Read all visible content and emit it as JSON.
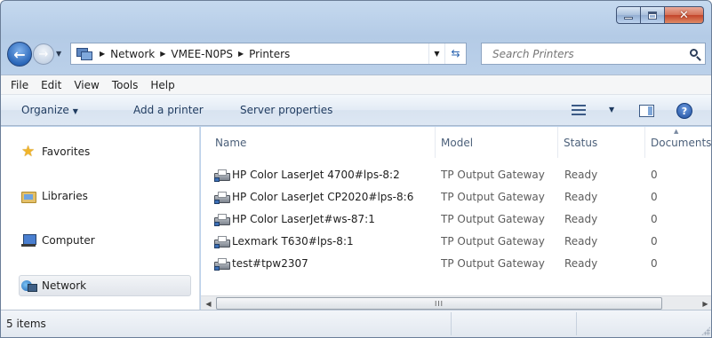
{
  "window": {
    "caption_buttons": {
      "minimize_icon": "minimize-icon",
      "maximize_icon": "maximize-icon",
      "close_glyph": "✕"
    }
  },
  "address_bar": {
    "crumbs": [
      "Network",
      "VMEE-N0PS",
      "Printers"
    ],
    "separator_glyph": "▶"
  },
  "search": {
    "placeholder": "Search Printers"
  },
  "menu": [
    "File",
    "Edit",
    "View",
    "Tools",
    "Help"
  ],
  "command_bar": {
    "organize": "Organize",
    "add_printer": "Add a printer",
    "server_properties": "Server properties"
  },
  "nav_pane": {
    "favorites": "Favorites",
    "libraries": "Libraries",
    "computer": "Computer",
    "network": "Network"
  },
  "columns": {
    "name": "Name",
    "model": "Model",
    "status": "Status",
    "documents": "Documents"
  },
  "printers": [
    {
      "name": "HP Color LaserJet 4700#lps-8:2",
      "model": "TP Output Gateway",
      "status": "Ready",
      "documents": "0"
    },
    {
      "name": "HP Color LaserJet CP2020#lps-8:6",
      "model": "TP Output Gateway",
      "status": "Ready",
      "documents": "0"
    },
    {
      "name": "HP Color LaserJet#ws-87:1",
      "model": "TP Output Gateway",
      "status": "Ready",
      "documents": "0"
    },
    {
      "name": "Lexmark T630#lps-8:1",
      "model": "TP Output Gateway",
      "status": "Ready",
      "documents": "0"
    },
    {
      "name": "test#tpw2307",
      "model": "TP Output Gateway",
      "status": "Ready",
      "documents": "0"
    }
  ],
  "scrollbar": {
    "thumb_grip": "III"
  },
  "status_bar": {
    "item_count": "5 items"
  },
  "colors": {
    "title_gradient": "#c5d9ef",
    "close_button": "#c3442a",
    "accent": "#2a64b0"
  }
}
